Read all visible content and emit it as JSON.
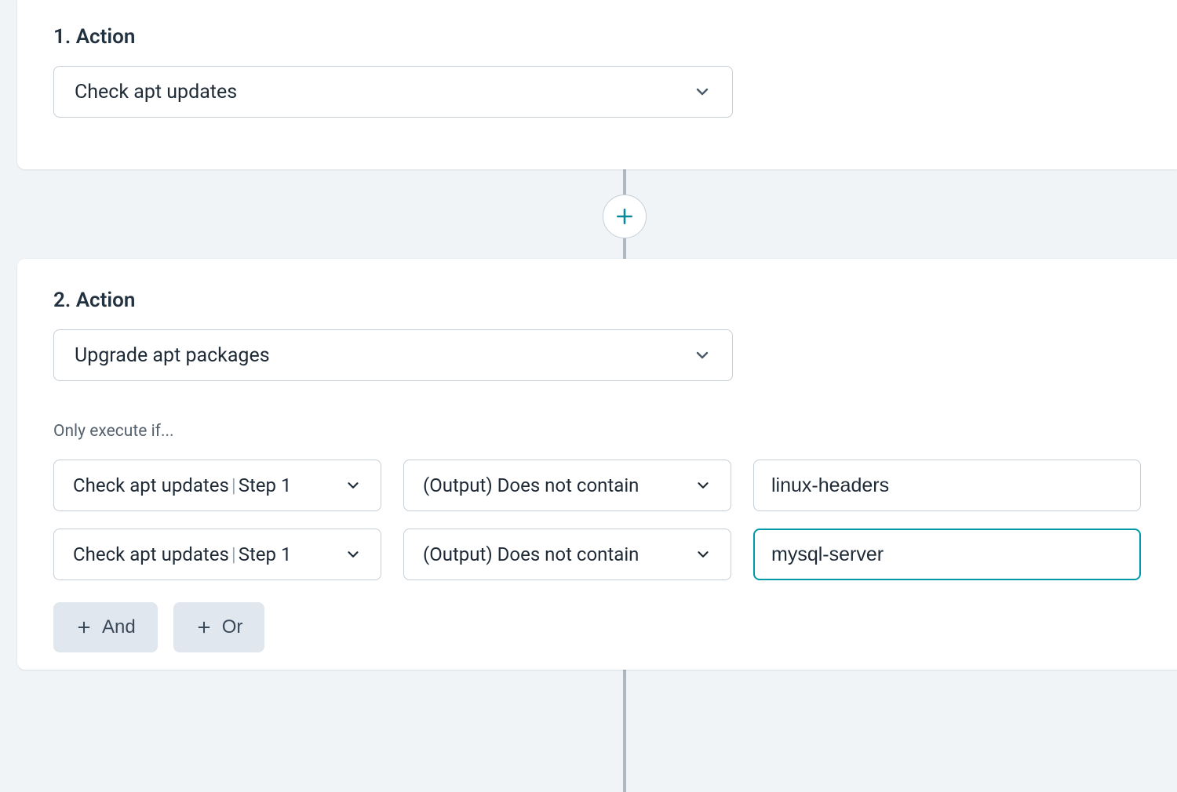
{
  "steps": [
    {
      "title": "1. Action",
      "action_value": "Check apt updates"
    },
    {
      "title": "2. Action",
      "action_value": "Upgrade apt packages",
      "condition_heading": "Only execute if...",
      "conditions": [
        {
          "source_label": "Check apt updates",
          "source_sep": "|",
          "source_step": "Step 1",
          "operator": "(Output) Does not contain",
          "value": "linux-headers",
          "focused": false
        },
        {
          "source_label": "Check apt updates",
          "source_sep": "|",
          "source_step": "Step 1",
          "operator": "(Output) Does not contain",
          "value": "mysql-server",
          "focused": true
        }
      ],
      "buttons": {
        "and": "And",
        "or": "Or"
      }
    }
  ]
}
